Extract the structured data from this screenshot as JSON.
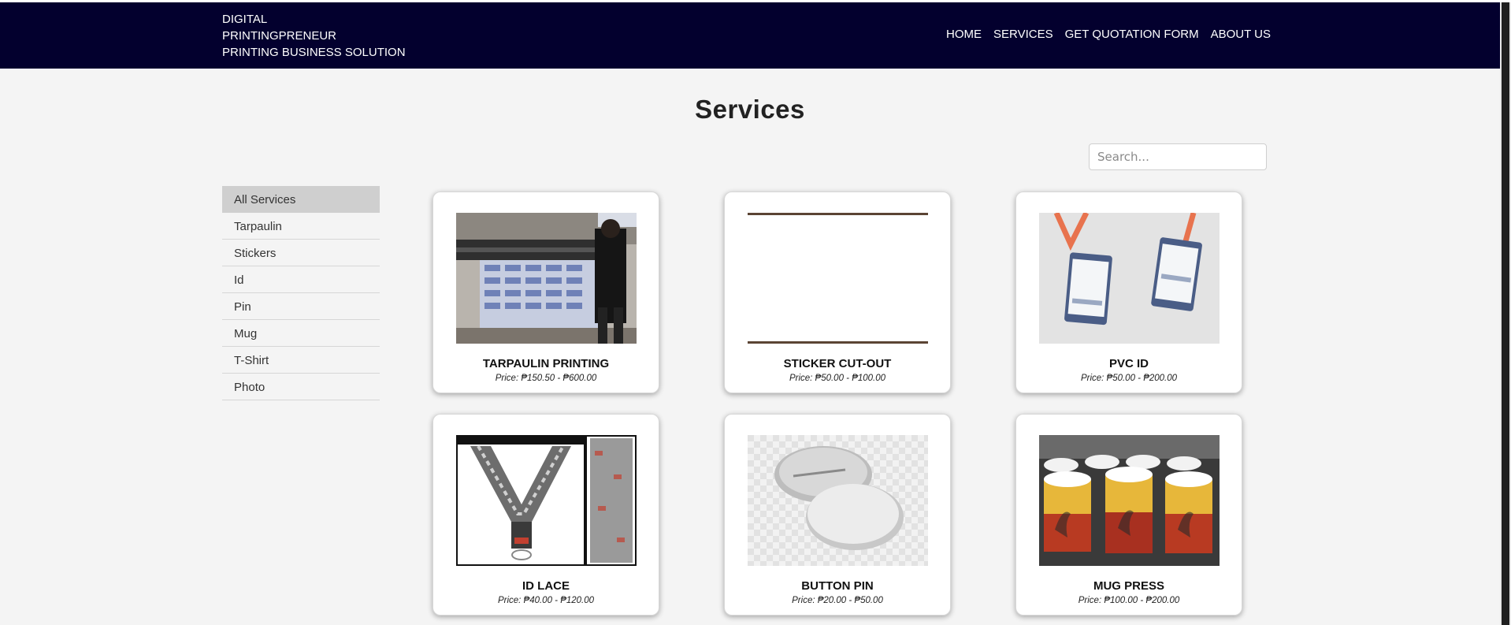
{
  "brand": {
    "line1": "DIGITAL",
    "line2": "PRINTINGPRENEUR",
    "line3": "PRINTING BUSINESS SOLUTION"
  },
  "nav": {
    "home": "HOME",
    "services": "SERVICES",
    "quotation": "GET QUOTATION FORM",
    "about": "ABOUT US"
  },
  "page": {
    "title": "Services"
  },
  "search": {
    "placeholder": "Search..."
  },
  "categories": [
    "All Services",
    "Tarpaulin",
    "Stickers",
    "Id",
    "Pin",
    "Mug",
    "T-Shirt",
    "Photo"
  ],
  "services": [
    {
      "name": "TARPAULIN PRINTING",
      "price": "Price: ₱150.50 - ₱600.00",
      "image_icon": "printer-photo"
    },
    {
      "name": "STICKER CUT-OUT",
      "price": "Price: ₱50.00 - ₱100.00",
      "image_icon": "blank-photo"
    },
    {
      "name": "PVC ID",
      "price": "Price: ₱50.00 - ₱200.00",
      "image_icon": "id-card-photo"
    },
    {
      "name": "ID LACE",
      "price": "Price: ₱40.00 - ₱120.00",
      "image_icon": "lanyard-photo"
    },
    {
      "name": "BUTTON PIN",
      "price": "Price: ₱20.00 - ₱50.00",
      "image_icon": "button-pin-photo"
    },
    {
      "name": "MUG PRESS",
      "price": "Price: ₱100.00 - ₱200.00",
      "image_icon": "mugs-photo"
    }
  ],
  "colors": {
    "header": "#03002e",
    "active_category": "#cfcfcf",
    "page_bg": "#f4f4f4"
  }
}
